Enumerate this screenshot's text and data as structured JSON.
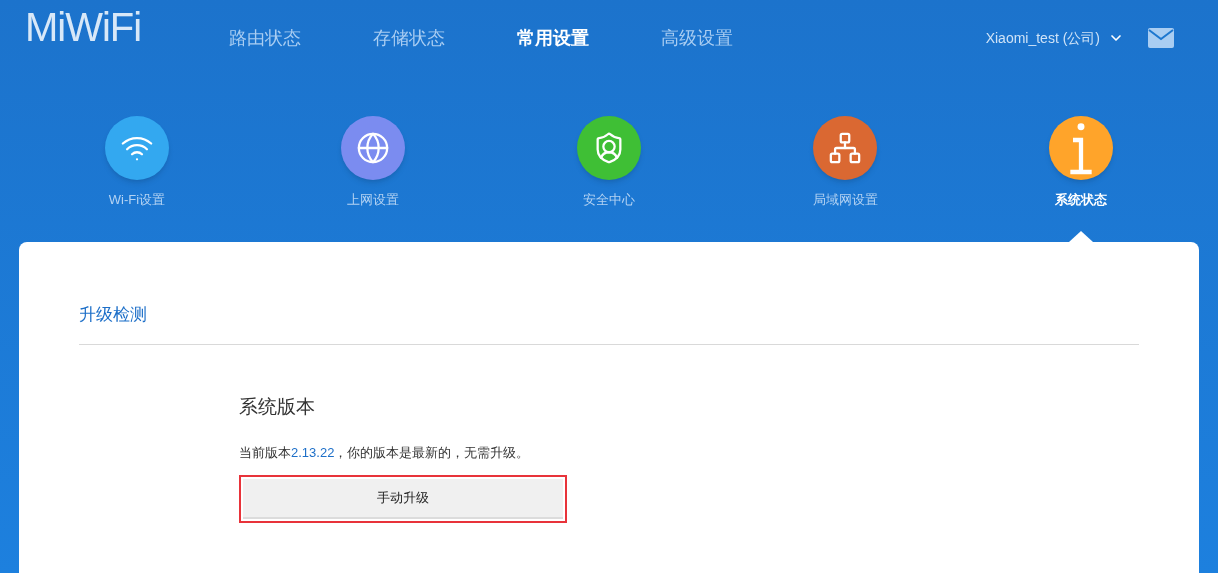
{
  "header": {
    "logo": "MiWiFi",
    "nav": [
      {
        "label": "路由状态",
        "selected": false
      },
      {
        "label": "存储状态",
        "selected": false
      },
      {
        "label": "常用设置",
        "selected": true
      },
      {
        "label": "高级设置",
        "selected": false
      }
    ],
    "user": "Xiaomi_test (公司)"
  },
  "settings": [
    {
      "label": "Wi-Fi设置",
      "kind": "wifi",
      "color": "#33a8f0",
      "selected": false
    },
    {
      "label": "上网设置",
      "kind": "globe",
      "color": "#7b8cf0",
      "selected": false
    },
    {
      "label": "安全中心",
      "kind": "shield",
      "color": "#3fbf35",
      "selected": false
    },
    {
      "label": "局域网设置",
      "kind": "network",
      "color": "#da6832",
      "selected": false
    },
    {
      "label": "系统状态",
      "kind": "info",
      "color": "#ffa42a",
      "selected": true
    }
  ],
  "panel": {
    "title": "升级检测",
    "section_title": "系统版本",
    "message": {
      "before": "当前版本",
      "version": "2.13.22",
      "after": "，你的版本是最新的，无需升级。"
    },
    "button": "手动升级",
    "highlighted": true
  }
}
